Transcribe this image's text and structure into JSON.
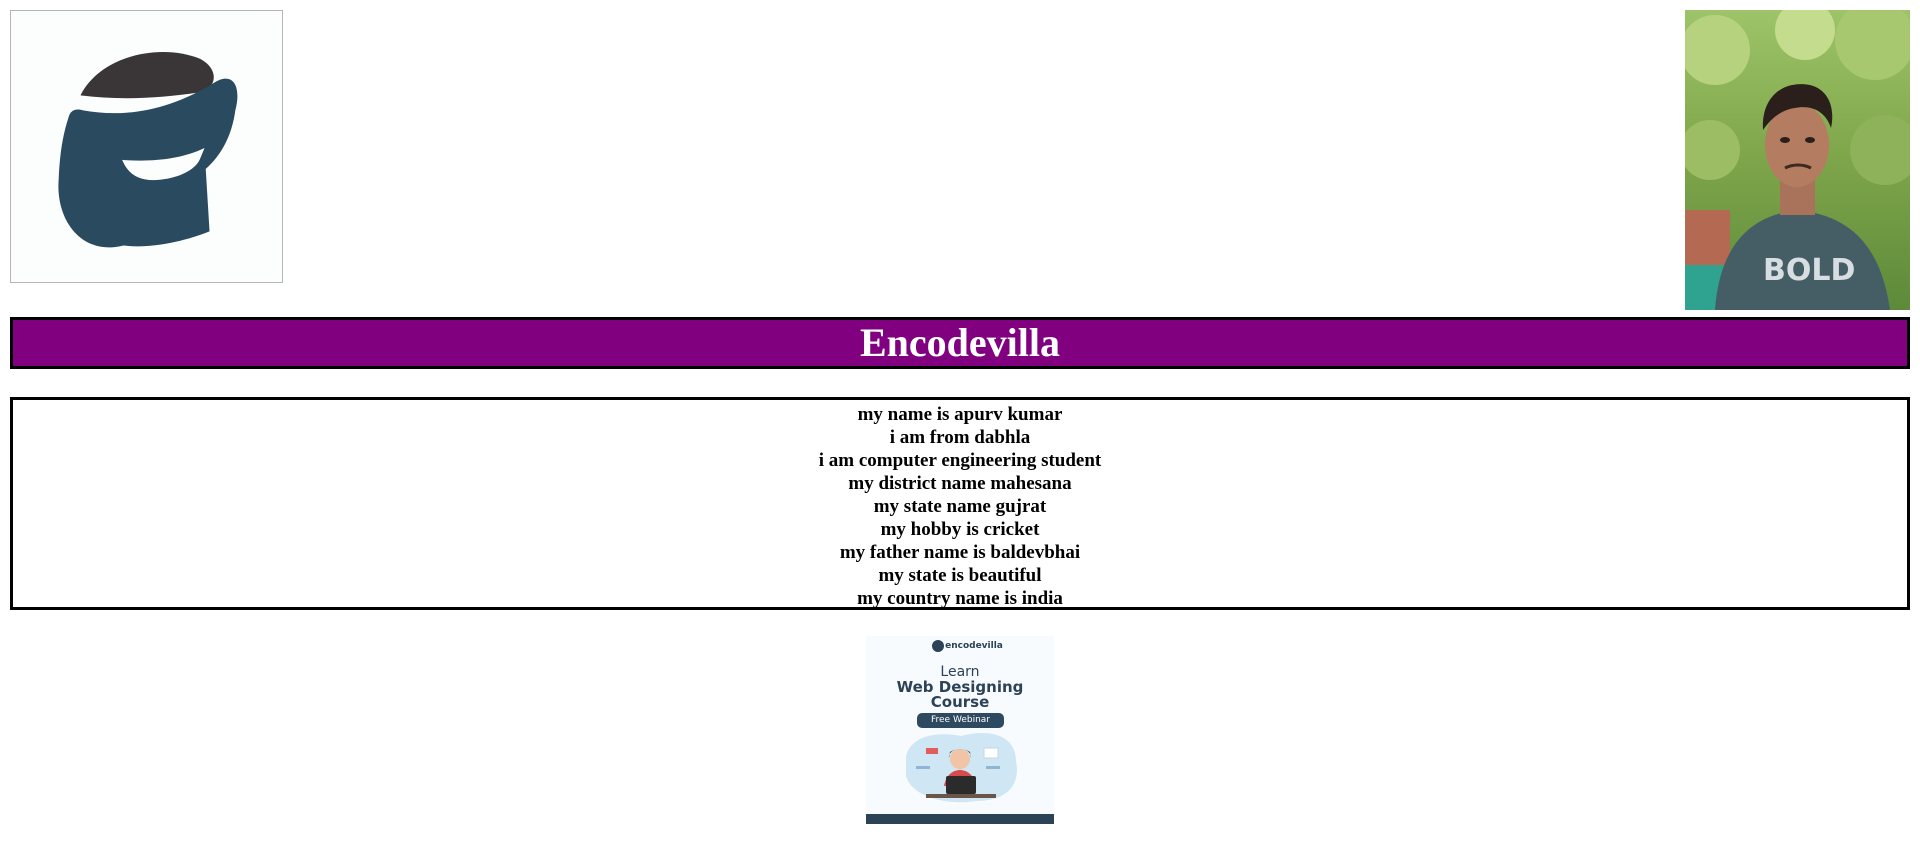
{
  "header": {
    "logo_icon": "encodevilla-e-logo",
    "profile_photo": "profile-photo"
  },
  "banner": {
    "title": "Encodevilla",
    "background_color": "#800080",
    "text_color": "#ffffff"
  },
  "info": {
    "lines": [
      "my name is apurv kumar",
      "i am from dabhla",
      "i am computer engineering student",
      "my district name mahesana",
      "my state name gujrat",
      "my hobby is cricket",
      "my father name is baldevbhai",
      "my state is beautiful",
      "my country name is india"
    ]
  },
  "poster": {
    "brand": "encodevilla",
    "learn": "Learn",
    "course_line1": "Web Designing",
    "course_line2": "Course",
    "pill": "Free Webinar"
  }
}
